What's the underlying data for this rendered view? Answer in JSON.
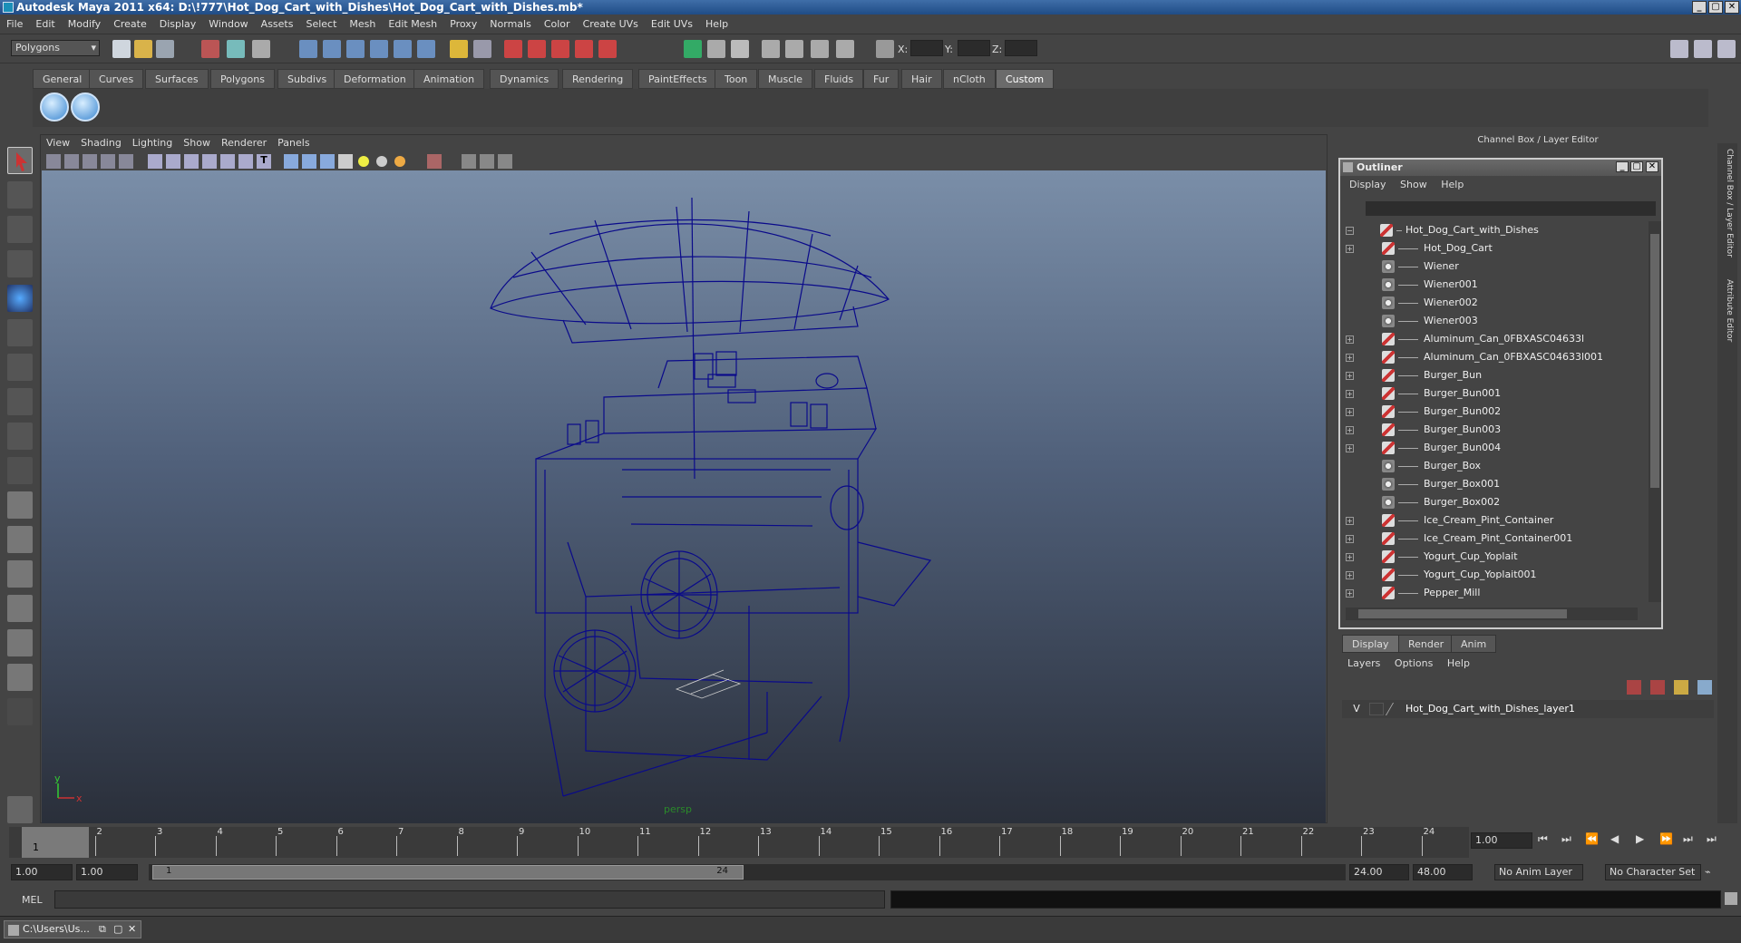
{
  "window": {
    "title": "Autodesk Maya 2011 x64: D:\\!777\\Hot_Dog_Cart_with_Dishes\\Hot_Dog_Cart_with_Dishes.mb*"
  },
  "menubar": [
    "File",
    "Edit",
    "Modify",
    "Create",
    "Display",
    "Window",
    "Assets",
    "Select",
    "Mesh",
    "Edit Mesh",
    "Proxy",
    "Normals",
    "Color",
    "Create UVs",
    "Edit UVs",
    "Help"
  ],
  "status": {
    "mode": "Polygons",
    "x_label": "X:",
    "y_label": "Y:",
    "z_label": "Z:"
  },
  "shelf_tabs": [
    "General",
    "Curves",
    "Surfaces",
    "Polygons",
    "Subdivs",
    "Deformation",
    "Animation",
    "Dynamics",
    "Rendering",
    "PaintEffects",
    "Toon",
    "Muscle",
    "Fluids",
    "Fur",
    "Hair",
    "nCloth",
    "Custom"
  ],
  "shelf_active": "Custom",
  "viewport": {
    "menu": [
      "View",
      "Shading",
      "Lighting",
      "Show",
      "Renderer",
      "Panels"
    ],
    "camera_label": "persp",
    "axis_x": "x",
    "axis_y": "y",
    "wire_color": "#0a0a8a"
  },
  "channel_box_title": "Channel Box / Layer Editor",
  "side_tabs": {
    "channel": "Channel Box / Layer Editor",
    "attribute": "Attribute Editor"
  },
  "outliner": {
    "title": "Outliner",
    "menu": [
      "Display",
      "Show",
      "Help"
    ],
    "items": [
      {
        "label": "Hot_Dog_Cart_with_Dishes",
        "expand": "−",
        "icon": "mesh",
        "depth": 0
      },
      {
        "label": "Hot_Dog_Cart",
        "expand": "+",
        "icon": "mesh",
        "depth": 1
      },
      {
        "label": "Wiener",
        "expand": "",
        "icon": "group",
        "depth": 1
      },
      {
        "label": "Wiener001",
        "expand": "",
        "icon": "group",
        "depth": 1
      },
      {
        "label": "Wiener002",
        "expand": "",
        "icon": "group",
        "depth": 1
      },
      {
        "label": "Wiener003",
        "expand": "",
        "icon": "group",
        "depth": 1
      },
      {
        "label": "Aluminum_Can_0FBXASC04633l",
        "expand": "+",
        "icon": "mesh",
        "depth": 1
      },
      {
        "label": "Aluminum_Can_0FBXASC04633l001",
        "expand": "+",
        "icon": "mesh",
        "depth": 1
      },
      {
        "label": "Burger_Bun",
        "expand": "+",
        "icon": "mesh",
        "depth": 1
      },
      {
        "label": "Burger_Bun001",
        "expand": "+",
        "icon": "mesh",
        "depth": 1
      },
      {
        "label": "Burger_Bun002",
        "expand": "+",
        "icon": "mesh",
        "depth": 1
      },
      {
        "label": "Burger_Bun003",
        "expand": "+",
        "icon": "mesh",
        "depth": 1
      },
      {
        "label": "Burger_Bun004",
        "expand": "+",
        "icon": "mesh",
        "depth": 1
      },
      {
        "label": "Burger_Box",
        "expand": "",
        "icon": "group",
        "depth": 1
      },
      {
        "label": "Burger_Box001",
        "expand": "",
        "icon": "group",
        "depth": 1
      },
      {
        "label": "Burger_Box002",
        "expand": "",
        "icon": "group",
        "depth": 1
      },
      {
        "label": "Ice_Cream_Pint_Container",
        "expand": "+",
        "icon": "mesh",
        "depth": 1
      },
      {
        "label": "Ice_Cream_Pint_Container001",
        "expand": "+",
        "icon": "mesh",
        "depth": 1
      },
      {
        "label": "Yogurt_Cup_Yoplait",
        "expand": "+",
        "icon": "mesh",
        "depth": 1
      },
      {
        "label": "Yogurt_Cup_Yoplait001",
        "expand": "+",
        "icon": "mesh",
        "depth": 1
      },
      {
        "label": "Pepper_Mill",
        "expand": "+",
        "icon": "mesh",
        "depth": 1
      }
    ]
  },
  "layer_editor": {
    "tabs": [
      "Display",
      "Render",
      "Anim"
    ],
    "active_tab": "Display",
    "menu": [
      "Layers",
      "Options",
      "Help"
    ],
    "layer": {
      "visible": "V",
      "name": "Hot_Dog_Cart_with_Dishes_layer1"
    }
  },
  "timeline": {
    "ticks": [
      "1",
      "2",
      "3",
      "4",
      "5",
      "6",
      "7",
      "8",
      "9",
      "10",
      "11",
      "12",
      "13",
      "14",
      "15",
      "16",
      "17",
      "18",
      "19",
      "20",
      "21",
      "22",
      "23",
      "24"
    ],
    "current_frame": "1",
    "current_time": "1.00"
  },
  "range": {
    "start": "1.00",
    "playback_start": "1.00",
    "slider_start": "1",
    "slider_end": "24",
    "playback_end": "24.00",
    "end": "48.00",
    "anim_layer": "No Anim Layer",
    "char_set": "No Character Set"
  },
  "cmdline": {
    "label": "MEL"
  },
  "taskbar": {
    "item": "C:\\Users\\Us..."
  }
}
